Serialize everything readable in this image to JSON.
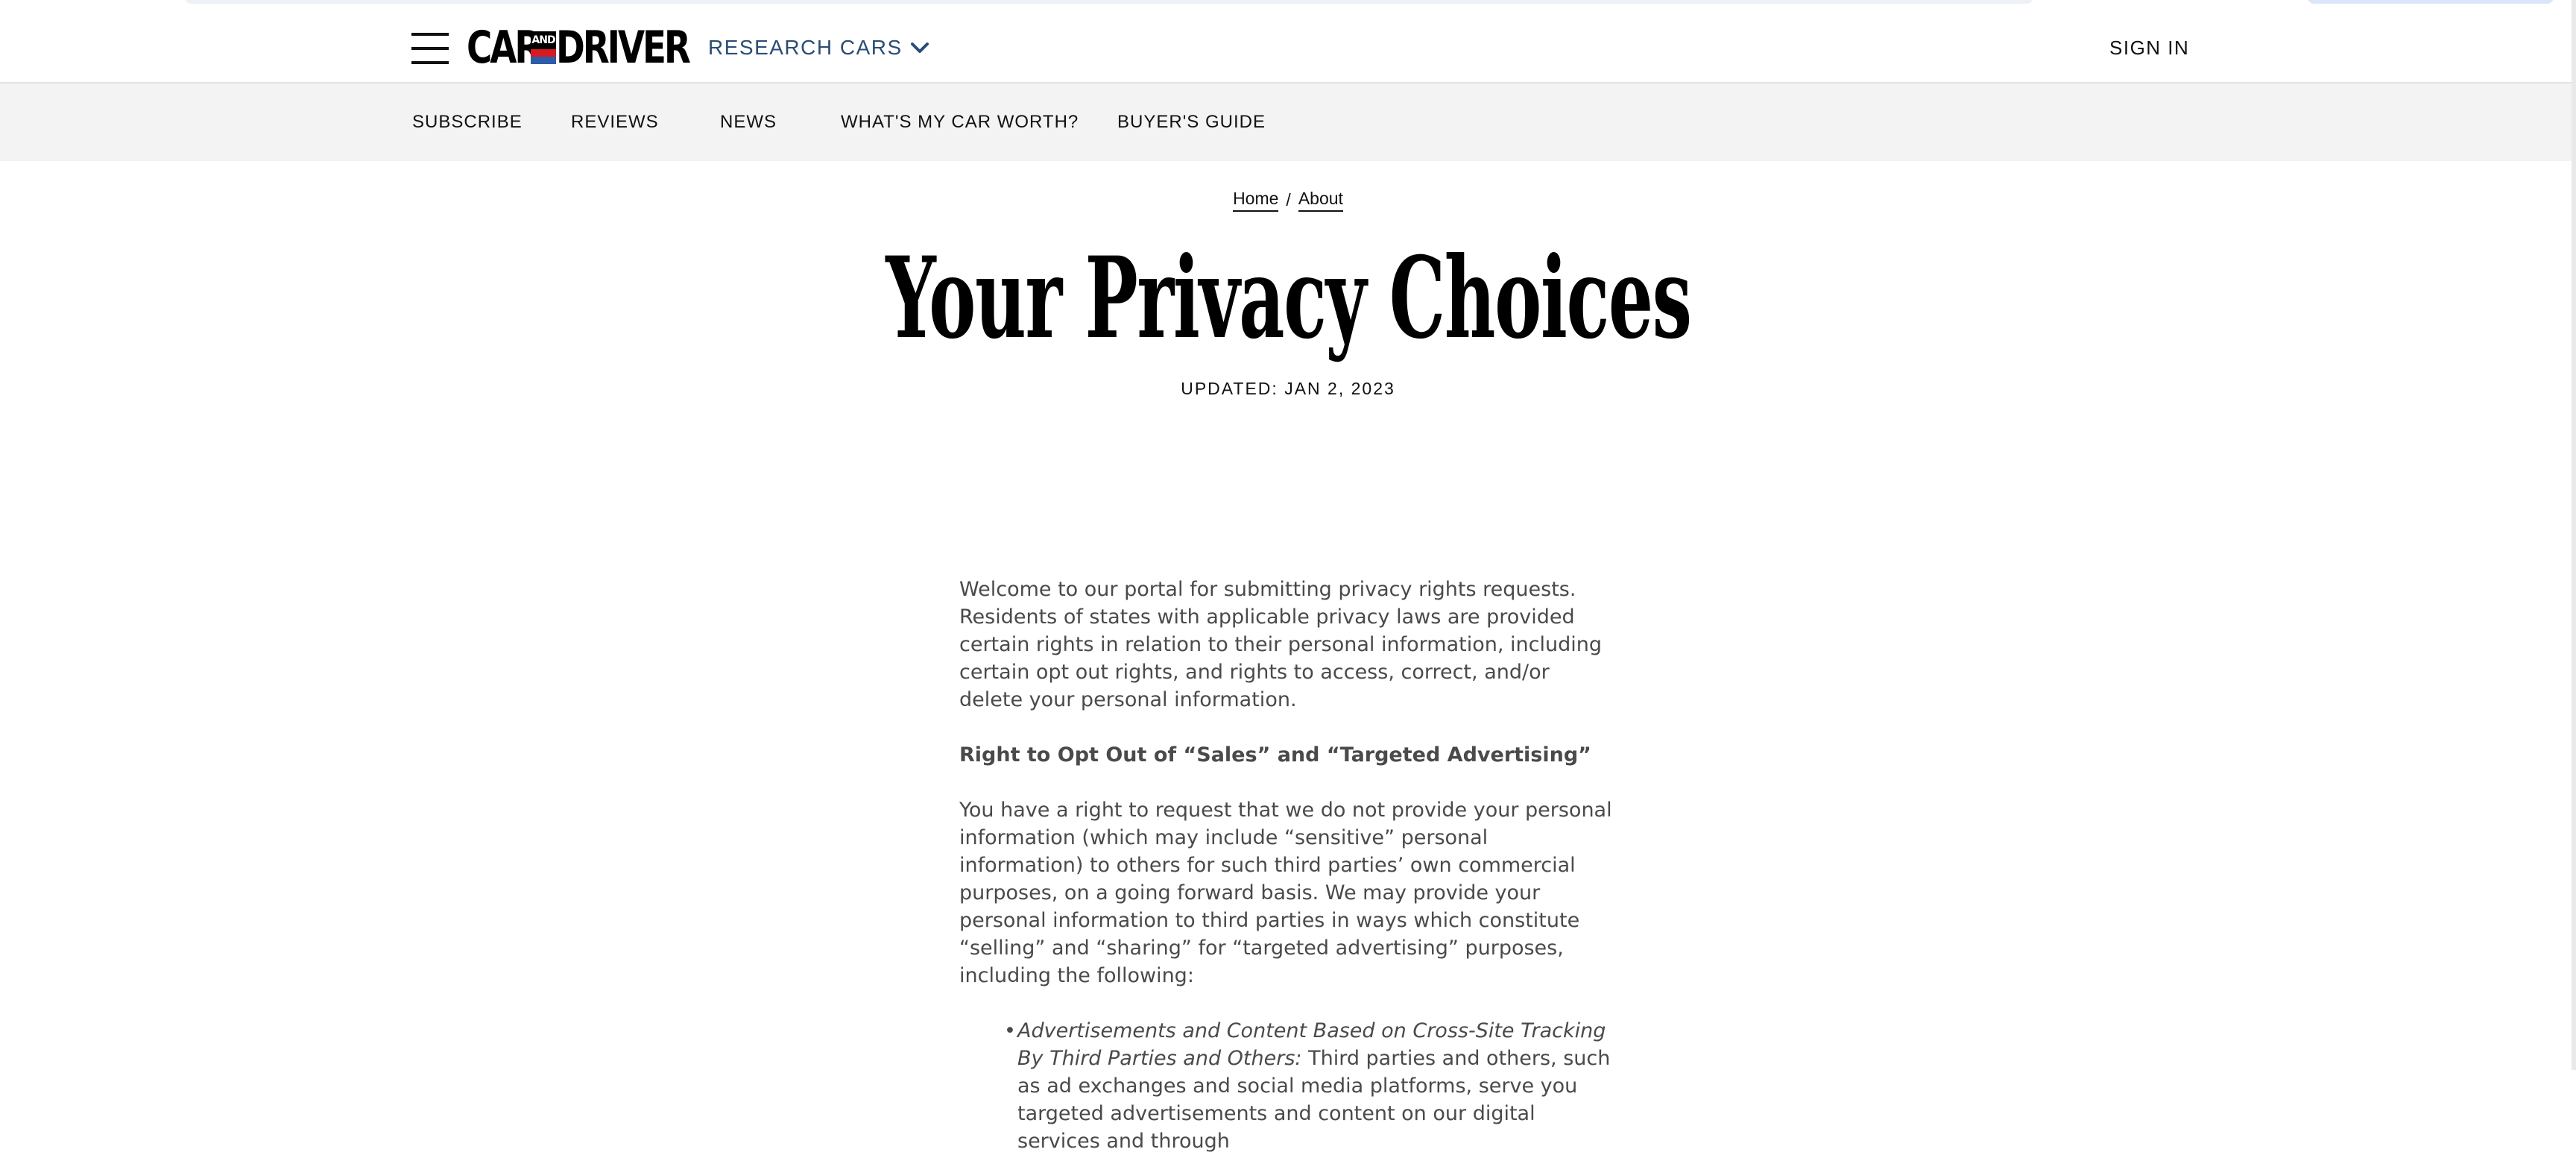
{
  "header": {
    "research_label": "RESEARCH CARS",
    "sign_in_label": "SIGN IN",
    "logo": {
      "car": "CAR",
      "and": "AND",
      "driver": "DRIVER"
    }
  },
  "subnav": {
    "items": [
      {
        "label": "SUBSCRIBE"
      },
      {
        "label": "REVIEWS"
      },
      {
        "label": "NEWS"
      },
      {
        "label": "WHAT'S MY CAR WORTH?"
      },
      {
        "label": "BUYER'S GUIDE"
      }
    ]
  },
  "breadcrumb": {
    "home": "Home",
    "separator": "/",
    "about": "About"
  },
  "page": {
    "title": "Your Privacy Choices",
    "updated": "UPDATED: JAN 2, 2023"
  },
  "article": {
    "intro": "Welcome to our portal for submitting privacy rights requests. Residents of states with applicable privacy laws are provided certain rights in relation to their personal information, including certain opt out rights, and rights to access, correct, and/or delete your personal information.",
    "heading": "Right to Opt Out of “Sales” and “Targeted Advertising”",
    "body": "You have a right to request that we do not provide your personal information (which may include “sensitive” personal information) to others for such third parties’ own commercial purposes, on a going forward basis. We may provide your personal information to third parties in ways which constitute “selling” and “sharing” for “targeted advertising” purposes, including the following:",
    "bullets": [
      {
        "title": "Advertisements and Content Based on Cross-Site Tracking By Third Parties and Others:",
        "text": " Third parties and others, such as ad exchanges and social media platforms, serve you targeted advertisements and content on our digital services and through"
      }
    ]
  },
  "colors": {
    "research_link": "#2a4d75",
    "subnav_bg": "#f3f3f3",
    "logo_red": "#d71920",
    "logo_blue": "#2f5ca8",
    "body_text": "#4a4a4a"
  },
  "icons": {
    "menu": "hamburger-menu-icon",
    "research_chevron": "chevron-down-icon"
  }
}
